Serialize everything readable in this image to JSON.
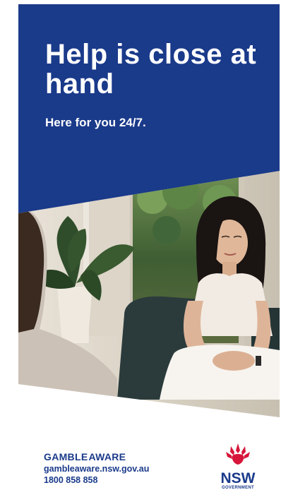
{
  "hero": {
    "headline": "Help is close at hand",
    "subheading": "Here for you 24/7."
  },
  "footer": {
    "brand_part1": "GAMBLE",
    "brand_part2": "AWARE",
    "website": "gambleaware.nsw.gov.au",
    "phone": "1800 858 858",
    "gov_logo_main": "NSW",
    "gov_logo_sub": "GOVERNMENT"
  },
  "colors": {
    "brand_blue": "#1a3a8a",
    "waratah_red": "#d7153a"
  },
  "icons": {
    "gov_logo": "nsw-waratah-logo"
  }
}
